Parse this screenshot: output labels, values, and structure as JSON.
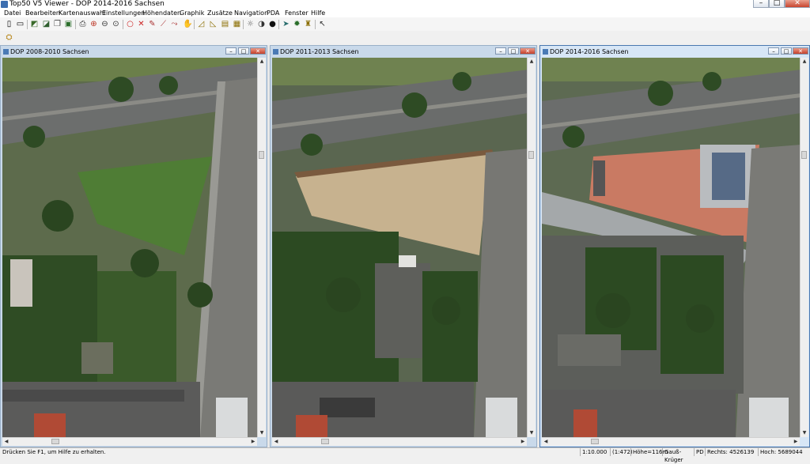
{
  "app": {
    "title": "Top50 V5 Viewer - DOP 2014-2016 Sachsen",
    "controls": {
      "minimize": "–",
      "maximize": "□",
      "close": "✕"
    }
  },
  "menu": [
    "Datei",
    "Bearbeiten",
    "Kartenauswahl",
    "Einstellungen",
    "Höhendaten",
    "Graphik",
    "Zusätze",
    "Navigation",
    "PDA",
    "Fenster",
    "Hilfe"
  ],
  "toolbar": {
    "icons": [
      "new-icon",
      "open-icon",
      "map-select-icon",
      "layers-icon",
      "copy-icon",
      "export-icon",
      "print-icon",
      "zoom-icon",
      "zoom-in-icon",
      "zoom-out-icon",
      "zoom-full-icon",
      "circle-icon",
      "cross-tool-icon",
      "pencil-icon",
      "wand-icon",
      "route-icon",
      "hand-icon",
      "measure-icon",
      "profile-icon",
      "sheet-icon",
      "grid-icon",
      "sun-icon",
      "contrast-icon",
      "disk-icon",
      "compass-icon",
      "globe-icon",
      "person-icon",
      "help-cursor-icon"
    ]
  },
  "windows": [
    {
      "title": "DOP 2008-2010 Sachsen",
      "active": false
    },
    {
      "title": "DOP 2011-2013 Sachsen",
      "active": false
    },
    {
      "title": "DOP 2014-2016 Sachsen",
      "active": true
    }
  ],
  "status": {
    "hint": "Drücken Sie F1, um Hilfe zu erhalten.",
    "scale": "1:10.000",
    "scale_alt": "(1:472)",
    "height": "Höhe=116m",
    "crs": "Gauß-Krüger",
    "pd": "PD",
    "right": "Rechts: 4526139",
    "up": "Hoch: 5689044"
  },
  "colors": {
    "active_border": "#4a78b0",
    "inactive_border": "#9ab0c8",
    "close_button": "#c8452e"
  }
}
